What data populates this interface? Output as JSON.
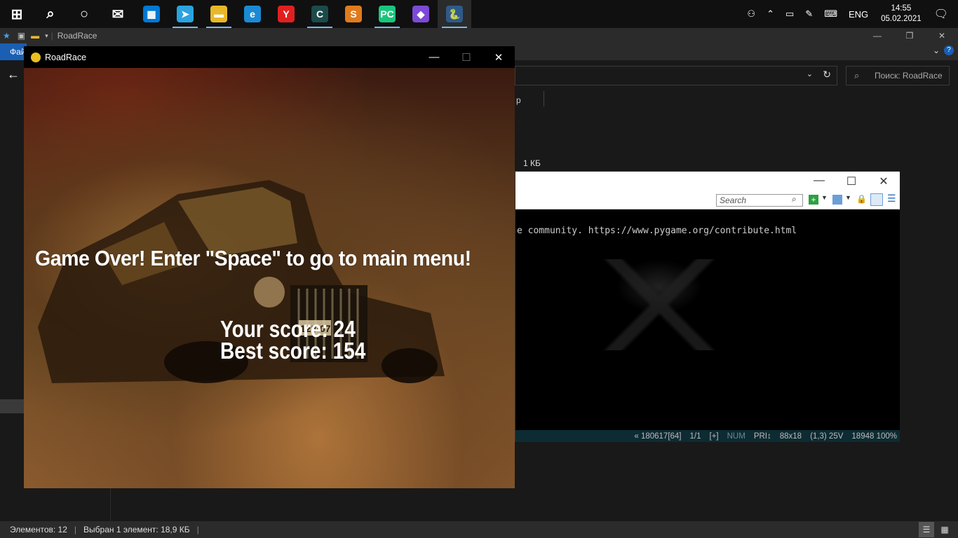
{
  "taskbar": {
    "apps": [
      {
        "name": "start-icon",
        "glyph": "⊞",
        "color": "#101010"
      },
      {
        "name": "search-icon",
        "glyph": "⌕",
        "color": "#101010"
      },
      {
        "name": "cortana-icon",
        "glyph": "○",
        "color": "#101010"
      },
      {
        "name": "mail-icon",
        "glyph": "✉",
        "color": "#101010"
      },
      {
        "name": "store-icon",
        "glyph": "▦",
        "color": "#0078d4"
      },
      {
        "name": "telegram-icon",
        "glyph": "➤",
        "color": "#2aa3df"
      },
      {
        "name": "explorer-icon",
        "glyph": "▬",
        "color": "#e8b828"
      },
      {
        "name": "edge-icon",
        "glyph": "e",
        "color": "#1a8ad4"
      },
      {
        "name": "yandex-icon",
        "glyph": "Y",
        "color": "#e02020"
      },
      {
        "name": "conemu-icon",
        "glyph": "C",
        "color": "#1c4a4a"
      },
      {
        "name": "sublime-icon",
        "glyph": "S",
        "color": "#e07b1c"
      },
      {
        "name": "pycharm-icon",
        "glyph": "PC",
        "color": "#1bc47d"
      },
      {
        "name": "visual-studio-icon",
        "glyph": "◆",
        "color": "#7b4ad6"
      },
      {
        "name": "python-icon",
        "glyph": "🐍",
        "color": "#2e5a8a"
      }
    ],
    "tray": {
      "language": "ENG",
      "time": "14:55",
      "date": "05.02.2021"
    }
  },
  "explorer": {
    "title": "RoadRace",
    "file_tab": "Фай",
    "search_placeholder": "Поиск: RoadRace",
    "column_fragment": "р",
    "size_fragment": "1 КБ",
    "status": {
      "items": "Элементов: 12",
      "selected": "Выбран 1 элемент: 18,9 КБ"
    }
  },
  "console": {
    "search_placeholder": "Search",
    "line": "e community. https://www.pygame.org/contribute.html",
    "status": [
      "« 180617[64]",
      "1/1",
      "[+]",
      "NUM",
      "PRI↕",
      "88x18",
      "(1,3) 25V",
      "18948 100%"
    ]
  },
  "game": {
    "title": "RoadRace",
    "message": "Game Over! Enter \"Space\" to go to main menu!",
    "your_score": "Your score: 24",
    "best_score": "Best score: 154",
    "license_plate": "128-07"
  }
}
